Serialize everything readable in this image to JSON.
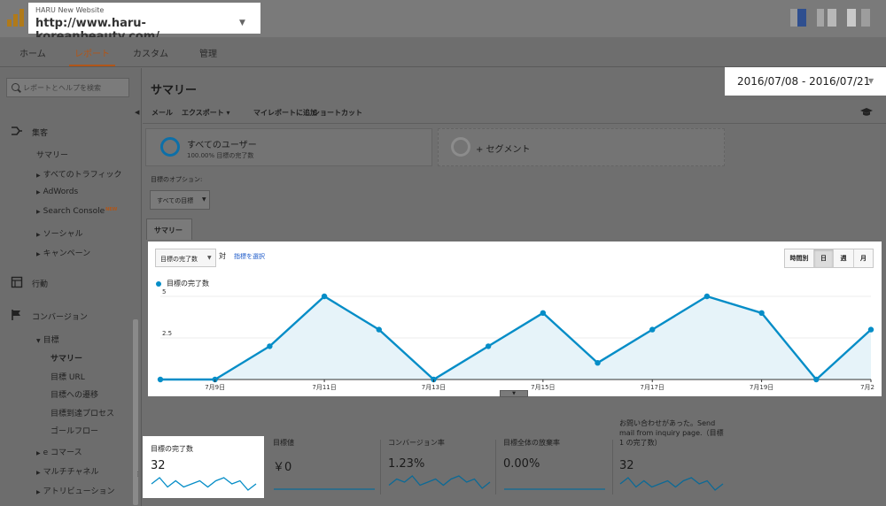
{
  "header": {
    "site_name": "HARU New Website",
    "site_url": "http://www.haru-koreanbeauty.com/"
  },
  "nav": {
    "tabs": [
      {
        "label": "ホーム",
        "active": false
      },
      {
        "label": "レポート",
        "active": true
      },
      {
        "label": "カスタム",
        "active": false
      },
      {
        "label": "管理",
        "active": false
      }
    ]
  },
  "sidebar": {
    "search_placeholder": "レポートとヘルプを検索",
    "sections": {
      "acquisition": {
        "label": "集客",
        "items": [
          "サマリー",
          "すべてのトラフィック",
          "AdWords",
          "Search Console",
          "ソーシャル",
          "キャンペーン"
        ],
        "new_badge": "NEW"
      },
      "behavior": {
        "label": "行動"
      },
      "conversions": {
        "label": "コンバージョン",
        "goals_label": "目標",
        "goal_items": [
          "サマリー",
          "目標 URL",
          "目標への遷移",
          "目標到達プロセス",
          "ゴールフロー"
        ],
        "other_items": [
          "e コマース",
          "マルチチャネル",
          "アトリビューション"
        ]
      }
    }
  },
  "main": {
    "title": "サマリー",
    "date_range": "2016/07/08 - 2016/07/21",
    "toolbar": [
      "メール",
      "エクスポート",
      "マイレポートに追加",
      "ショートカット"
    ],
    "segments": [
      {
        "title": "すべてのユーザー",
        "subtitle": "100.00% 目標の完了数"
      },
      {
        "title": "+ セグメント"
      }
    ],
    "goal_option_label": "目標のオプション:",
    "goal_select": "すべての目標",
    "summary_tab": "サマリー",
    "chart_controls": {
      "metric_select": "目標の完了数",
      "vs": "対",
      "pick_metric": "指標を選択",
      "periods": [
        {
          "label": "時間別",
          "selected": false
        },
        {
          "label": "日",
          "selected": true
        },
        {
          "label": "週",
          "selected": false
        },
        {
          "label": "月",
          "selected": false
        }
      ]
    },
    "scorecards": [
      {
        "label": "目標の完了数",
        "value": "32",
        "spark": [
          2,
          4,
          1,
          3,
          1,
          2,
          3,
          1,
          3,
          4,
          2,
          3,
          0,
          2
        ]
      },
      {
        "label": "目標値",
        "value": "￥0",
        "spark": [
          0,
          0,
          0,
          0,
          0,
          0,
          0,
          0,
          0,
          0,
          0,
          0,
          0,
          0
        ]
      },
      {
        "label": "コンバージョン率",
        "value": "1.23%",
        "spark": [
          1,
          3,
          2,
          4,
          1,
          2,
          3,
          1,
          3,
          4,
          2,
          3,
          0,
          2
        ]
      },
      {
        "label": "目標全体の放棄率",
        "value": "0.00%",
        "spark": [
          0,
          0,
          0,
          0,
          0,
          0,
          0,
          0,
          0,
          0,
          0,
          0,
          0,
          0
        ]
      },
      {
        "label": "お問い合わせがあった。Send mail from inquiry page.（目標 1 の完了数）",
        "value": "32",
        "spark": [
          2,
          4,
          1,
          3,
          1,
          2,
          3,
          1,
          3,
          4,
          2,
          3,
          0,
          2
        ]
      }
    ]
  },
  "chart_data": {
    "type": "area",
    "series": [
      {
        "name": "目標の完了数",
        "color": "#058dc7",
        "values": [
          0,
          0,
          2,
          5,
          3,
          0,
          2,
          4,
          1,
          3,
          5,
          4,
          0,
          3
        ]
      }
    ],
    "x": [
      "7/8",
      "7/9",
      "7/10",
      "7/11",
      "7/12",
      "7/13",
      "7/14",
      "7/15",
      "7/16",
      "7/17",
      "7/18",
      "7/19",
      "7/20",
      "7/21"
    ],
    "x_tick_labels": [
      "7月9日",
      "7月11日",
      "7月13日",
      "7月15日",
      "7月17日",
      "7月19日",
      "7月2"
    ],
    "y_tick_labels": [
      "5",
      "2.5"
    ],
    "ylim": [
      0,
      5
    ],
    "grid": true
  }
}
